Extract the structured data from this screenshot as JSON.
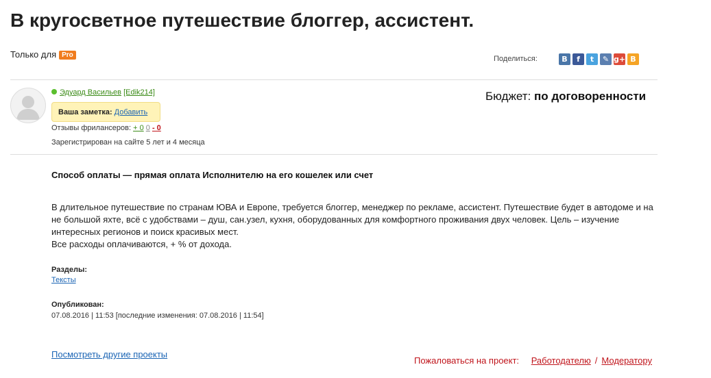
{
  "project": {
    "title": "В кругосветное путешествие блоггер, ассистент.",
    "only_for_label": "Только для",
    "pro_badge": "Pro"
  },
  "share": {
    "label": "Поделиться:",
    "icons": [
      {
        "name": "vkontakte-icon",
        "glyph": "В",
        "color": "#4a76a8"
      },
      {
        "name": "facebook-icon",
        "glyph": "f",
        "color": "#3b5998"
      },
      {
        "name": "twitter-icon",
        "glyph": "t",
        "color": "#4aa3df"
      },
      {
        "name": "livejournal-icon",
        "glyph": "✎",
        "color": "#5b7fb0"
      },
      {
        "name": "google-plus-icon",
        "glyph": "g+",
        "color": "#dd4b39"
      },
      {
        "name": "blogger-icon",
        "glyph": "B",
        "color": "#f5a425"
      }
    ]
  },
  "author": {
    "name": "Эдуард Васильев",
    "login": "[Edik214]",
    "note_label": "Ваша заметка:",
    "note_add": "Добавить",
    "reviews_label": "Отзывы фрилансеров:",
    "reviews_positive": "+ 0",
    "reviews_neutral": "0",
    "reviews_negative": "- 0",
    "registered": "Зарегистрирован на сайте 5 лет и 4 месяца",
    "online_color": "#5bbf2e"
  },
  "budget": {
    "label": "Бюджет:",
    "value": "по договоренности"
  },
  "payment": "Способ оплаты — прямая оплата Исполнителю на его кошелек или счет",
  "description": {
    "paragraph1": "В длительное путешествие по странам ЮВА и Европе, требуется блоггер, менеджер по рекламе, ассистент. Путешествие будет в автодоме и на не большой яхте, всё с удобствами – душ, сан.узел, кухня, оборудованных для комфортного проживания двух человек. Цель – изучение интересных регионов и поиск красивых мест.",
    "paragraph2": "Все расходы оплачиваются, + % от дохода."
  },
  "sections": {
    "label": "Разделы:",
    "link": "Тексты"
  },
  "published": {
    "label": "Опубликован:",
    "value": "07.08.2016 | 11:53 [последние изменения: 07.08.2016 | 11:54]"
  },
  "footer": {
    "other_projects": "Посмотреть другие проекты",
    "complaint_label": "Пожаловаться на проект:",
    "to_employer": "Работодателю",
    "separator": "/",
    "to_moderator": "Модератору"
  },
  "colors": {
    "accent_link": "#1a64b4",
    "complaint_red": "#c0141b",
    "pro_orange": "#f07c1e",
    "note_yellow": "#fff3b8"
  }
}
